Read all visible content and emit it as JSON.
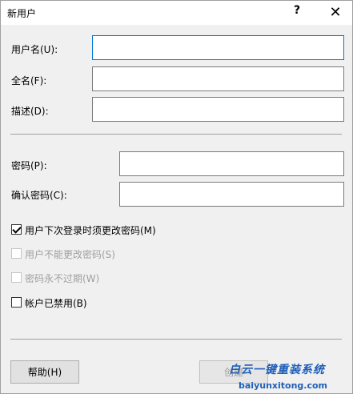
{
  "window": {
    "title": "新用户",
    "help_glyph": "?",
    "close_glyph": "✕"
  },
  "fields": {
    "username": {
      "label": "用户名(U):",
      "value": ""
    },
    "fullname": {
      "label": "全名(F):",
      "value": ""
    },
    "description": {
      "label": "描述(D):",
      "value": ""
    },
    "password": {
      "label": "密码(P):",
      "value": ""
    },
    "confirm": {
      "label": "确认密码(C):",
      "value": ""
    }
  },
  "checkboxes": [
    {
      "label": "用户下次登录时须更改密码(M)",
      "checked": true,
      "enabled": true
    },
    {
      "label": "用户不能更改密码(S)",
      "checked": false,
      "enabled": false
    },
    {
      "label": "密码永不过期(W)",
      "checked": false,
      "enabled": false
    },
    {
      "label": "帐户已禁用(B)",
      "checked": false,
      "enabled": true
    }
  ],
  "buttons": {
    "help": "帮助(H)",
    "create": "创建"
  },
  "watermark": {
    "line1": "白云一键重装系统",
    "line2": "baiyunxitong.com"
  }
}
